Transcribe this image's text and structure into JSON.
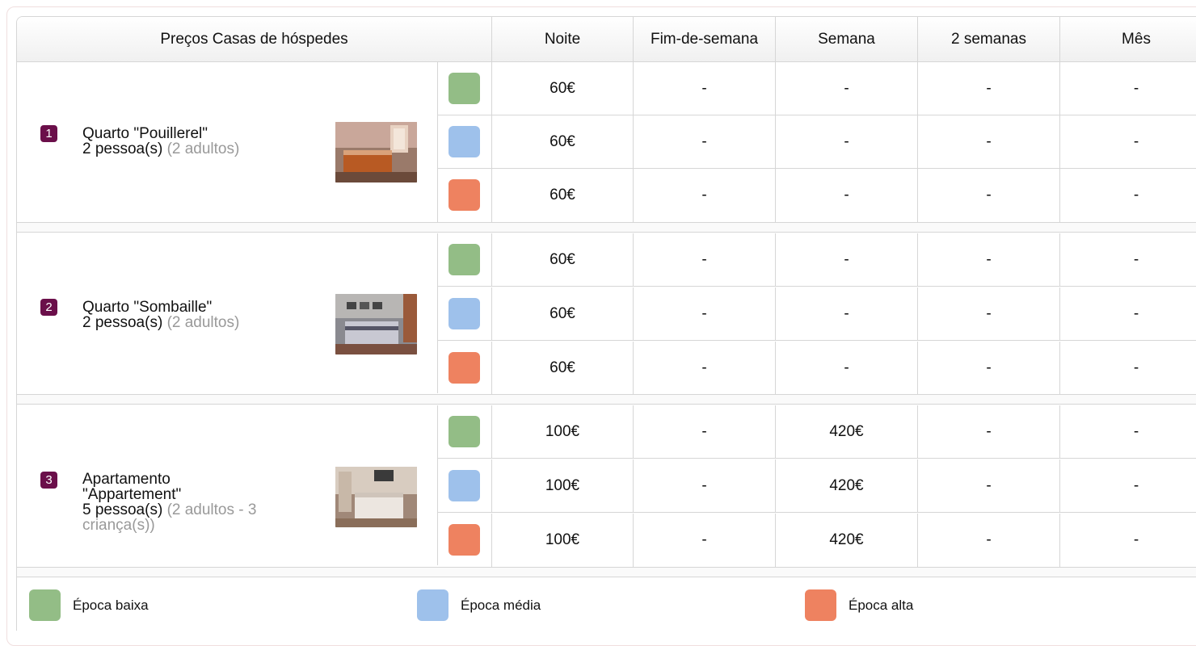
{
  "header": {
    "title": "Preços Casas de hóspedes",
    "columns": [
      "Noite",
      "Fim-de-semana",
      "Semana",
      "2 semanas",
      "Mês"
    ]
  },
  "colors": {
    "badge": "#6b0f4a",
    "epoca_baixa": "#93bd86",
    "epoca_media": "#9ec1eb",
    "epoca_alta": "#ee8260"
  },
  "rooms": [
    {
      "number": "1",
      "name": "Quarto \"Pouillerel\"",
      "capacity": "2 pessoa(s)",
      "details": "(2 adultos)",
      "photo": "bedroom-photo",
      "prices": [
        [
          "60€",
          "-",
          "-",
          "-",
          "-"
        ],
        [
          "60€",
          "-",
          "-",
          "-",
          "-"
        ],
        [
          "60€",
          "-",
          "-",
          "-",
          "-"
        ]
      ]
    },
    {
      "number": "2",
      "name": "Quarto \"Sombaille\"",
      "capacity": "2 pessoa(s)",
      "details": "(2 adultos)",
      "photo": "bedroom-photo",
      "prices": [
        [
          "60€",
          "-",
          "-",
          "-",
          "-"
        ],
        [
          "60€",
          "-",
          "-",
          "-",
          "-"
        ],
        [
          "60€",
          "-",
          "-",
          "-",
          "-"
        ]
      ]
    },
    {
      "number": "3",
      "name_line1": "Apartamento",
      "name_line2": "\"Appartement\"",
      "capacity": "5 pessoa(s)",
      "details_line1": "(2 adultos - 3",
      "details_line2": "criança(s))",
      "photo": "bedroom-photo",
      "prices": [
        [
          "100€",
          "-",
          "420€",
          "-",
          "-"
        ],
        [
          "100€",
          "-",
          "420€",
          "-",
          "-"
        ],
        [
          "100€",
          "-",
          "420€",
          "-",
          "-"
        ]
      ]
    }
  ],
  "legend": [
    "Época baixa",
    "Época média",
    "Época alta"
  ]
}
